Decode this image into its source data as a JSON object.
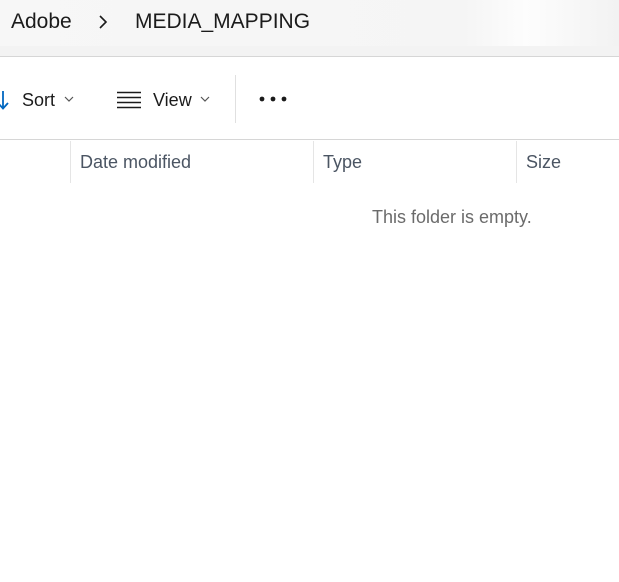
{
  "breadcrumb": {
    "items": [
      "Adobe",
      "MEDIA_MAPPING"
    ],
    "separator_icon": "chevron-right-icon"
  },
  "toolbar": {
    "sort_label": "Sort",
    "sort_icon": "sort-down-arrow-icon",
    "view_label": "View",
    "view_icon": "list-lines-icon",
    "more_icon": "more-dots-icon"
  },
  "columns": {
    "date_modified": "Date modified",
    "type": "Type",
    "size": "Size"
  },
  "content": {
    "empty_message": "This folder is empty."
  },
  "colors": {
    "accent": "#0067c0",
    "text": "#1b1b1b",
    "header_text": "#4b5563",
    "muted_text": "#6b6b6b"
  }
}
